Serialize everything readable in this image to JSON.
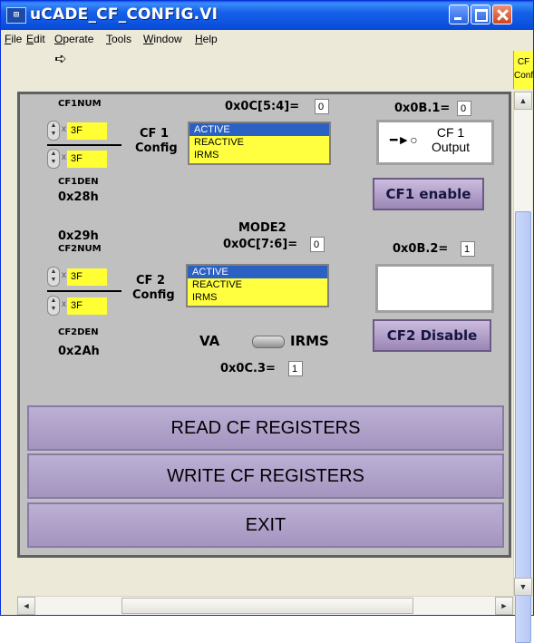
{
  "window": {
    "title": "uCADE_CF_CONFIG.VI",
    "icon": "labview-vi-icon"
  },
  "menu": {
    "items": [
      {
        "pre": "",
        "u": "F",
        "post": "ile"
      },
      {
        "pre": "",
        "u": "E",
        "post": "dit"
      },
      {
        "pre": "",
        "u": "O",
        "post": "perate"
      },
      {
        "pre": "",
        "u": "T",
        "post": "ools"
      },
      {
        "pre": "",
        "u": "W",
        "post": "indow"
      },
      {
        "pre": "",
        "u": "H",
        "post": "elp"
      }
    ]
  },
  "toolbar": {
    "run_icon": "run-arrow-icon",
    "cf_tag": {
      "line1": "CF",
      "line2": "Config"
    }
  },
  "cf1": {
    "num_label": "CF1NUM",
    "num_value": "3F",
    "den_value": "3F",
    "den_label": "CF1DEN",
    "den_addr": "0x28h",
    "config_line1": "CF 1",
    "config_line2": "Config",
    "reg_label": "0x0C[5:4]=",
    "reg_value": "0",
    "options": [
      "ACTIVE",
      "REACTIVE",
      "IRMS"
    ],
    "selected": "ACTIVE",
    "out_label": "0x0B.1=",
    "out_value": "0",
    "indicator_line1": "CF 1",
    "indicator_line2": "Output",
    "button_label": "CF1 enable"
  },
  "cf2": {
    "num_addr": "0x29h",
    "num_label": "CF2NUM",
    "num_value": "3F",
    "den_value": "3F",
    "den_label": "CF2DEN",
    "den_addr": "0x2Ah",
    "config_line1": "CF 2",
    "config_line2": "Config",
    "mode_label": "MODE2",
    "reg_label": "0x0C[7:6]=",
    "reg_value": "0",
    "options": [
      "ACTIVE",
      "REACTIVE",
      "IRMS"
    ],
    "selected": "ACTIVE",
    "out_label": "0x0B.2=",
    "out_value": "1",
    "button_label": "CF2 Disable"
  },
  "mode_switch": {
    "left_label": "VA",
    "right_label": "IRMS",
    "reg_label": "0x0C.3=",
    "reg_value": "1"
  },
  "actions": {
    "read": "READ CF REGISTERS",
    "write": "WRITE CF REGISTERS",
    "exit": "EXIT"
  }
}
